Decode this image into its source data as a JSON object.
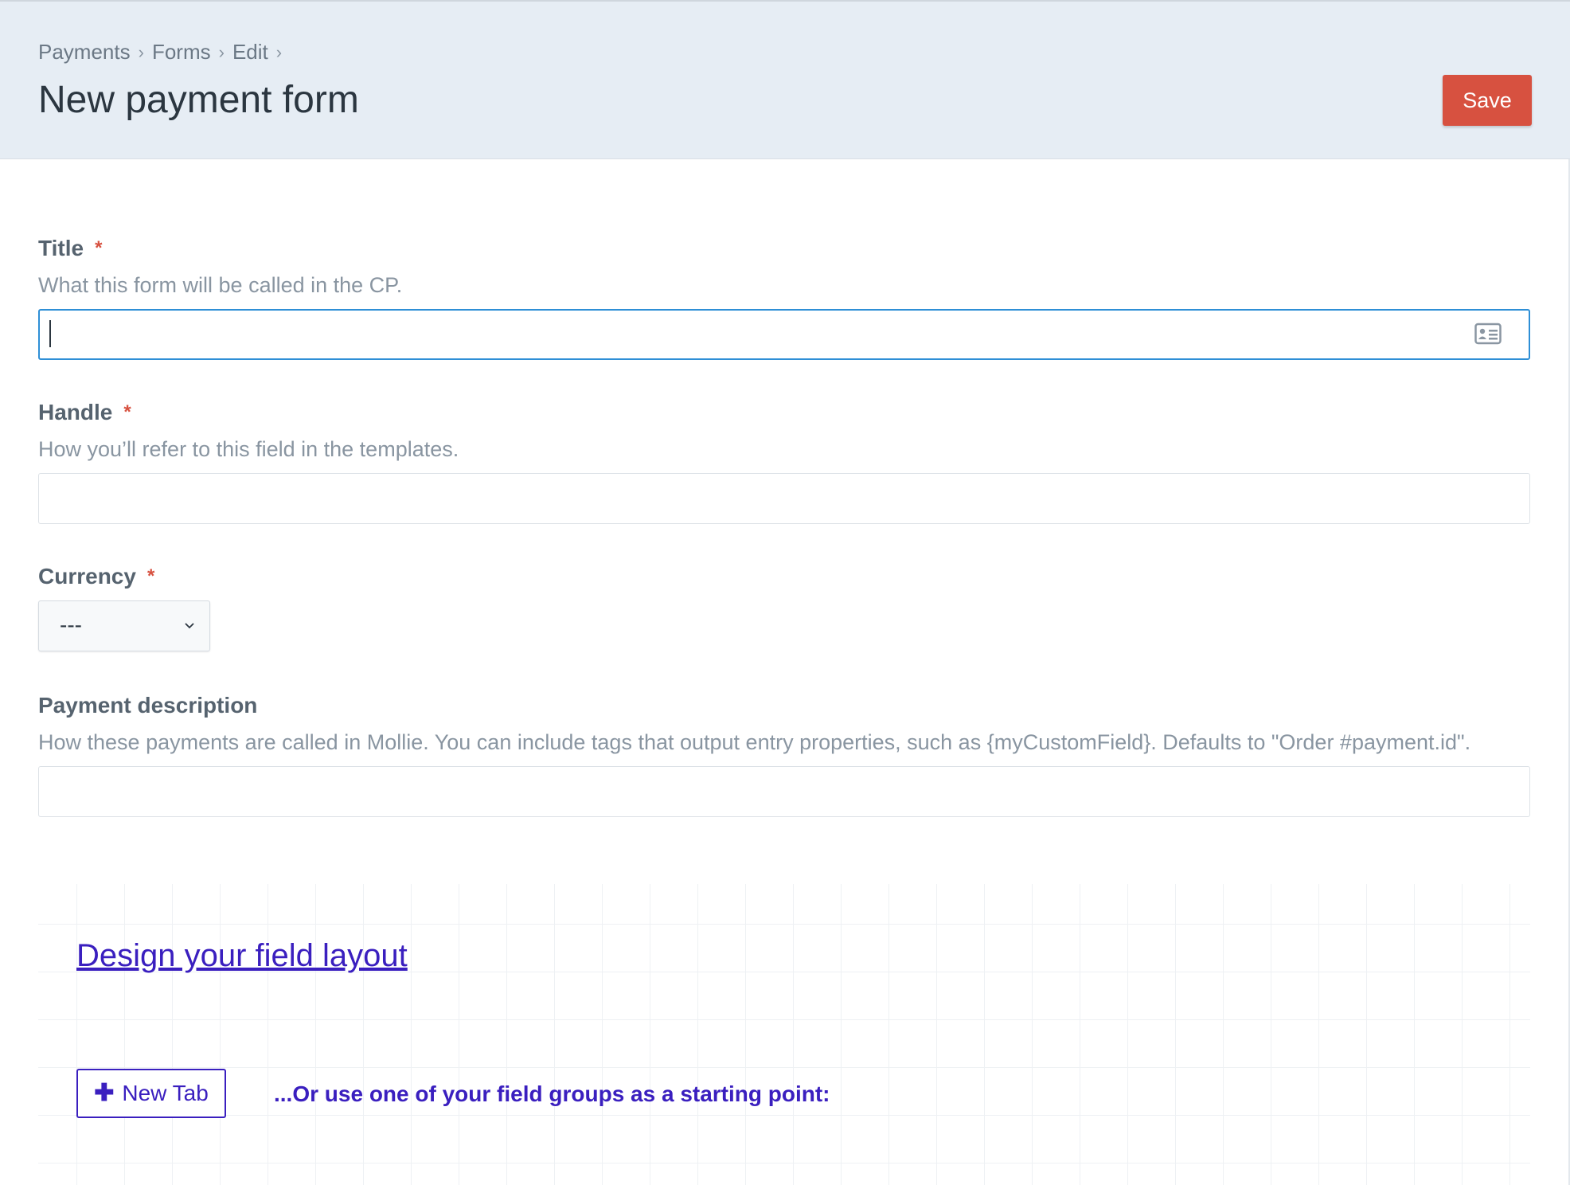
{
  "breadcrumb": {
    "items": [
      "Payments",
      "Forms",
      "Edit"
    ],
    "separator": "›"
  },
  "header": {
    "title": "New payment form",
    "save_label": "Save"
  },
  "fields": {
    "title": {
      "label": "Title",
      "required_mark": "*",
      "instructions": "What this form will be called in the CP.",
      "value": ""
    },
    "handle": {
      "label": "Handle",
      "required_mark": "*",
      "instructions": "How you’ll refer to this field in the templates.",
      "value": ""
    },
    "currency": {
      "label": "Currency",
      "required_mark": "*",
      "selected": "---"
    },
    "payment_description": {
      "label": "Payment description",
      "instructions": "How these payments are called in Mollie. You can include tags that output entry properties, such as {myCustomField}. Defaults to \"Order #payment.id\".",
      "value": ""
    }
  },
  "layout_designer": {
    "heading_link": "Design your field layout",
    "new_tab_label": "New Tab",
    "starting_point_text": "...Or use one of your field groups as a starting point:"
  },
  "colors": {
    "header_bg": "#e6edf4",
    "save_button": "#d75140",
    "required": "#d75140",
    "focus_border": "#2e8fd6",
    "link": "#3a1fbf"
  },
  "icons": {
    "title_input": "card-icon",
    "currency_select": "chevron-down-icon",
    "new_tab": "plus-icon"
  }
}
